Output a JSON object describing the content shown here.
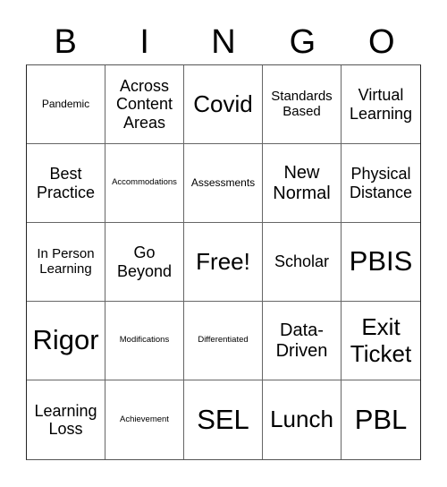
{
  "header": {
    "letters": [
      "B",
      "I",
      "N",
      "G",
      "O"
    ]
  },
  "board": {
    "cells": [
      {
        "text": "Pandemic",
        "size": "s-sm"
      },
      {
        "text": "Across Content Areas",
        "size": "s-lg"
      },
      {
        "text": "Covid",
        "size": "s-2xl"
      },
      {
        "text": "Standards Based",
        "size": "s-md"
      },
      {
        "text": "Virtual Learning",
        "size": "s-lg"
      },
      {
        "text": "Best Practice",
        "size": "s-lg"
      },
      {
        "text": "Accommodations",
        "size": "s-xs"
      },
      {
        "text": "Assessments",
        "size": "s-sm"
      },
      {
        "text": "New Normal",
        "size": "s-xl"
      },
      {
        "text": "Physical Distance",
        "size": "s-lg"
      },
      {
        "text": "In Person Learning",
        "size": "s-md"
      },
      {
        "text": "Go Beyond",
        "size": "s-lg"
      },
      {
        "text": "Free!",
        "size": "s-2xl"
      },
      {
        "text": "Scholar",
        "size": "s-lg"
      },
      {
        "text": "PBIS",
        "size": "s-3xl"
      },
      {
        "text": "Rigor",
        "size": "s-3xl"
      },
      {
        "text": "Modifications",
        "size": "s-xs"
      },
      {
        "text": "Differentiated",
        "size": "s-xs"
      },
      {
        "text": "Data-Driven",
        "size": "s-xl"
      },
      {
        "text": "Exit Ticket",
        "size": "s-2xl"
      },
      {
        "text": "Learning Loss",
        "size": "s-lg"
      },
      {
        "text": "Achievement",
        "size": "s-xs"
      },
      {
        "text": "SEL",
        "size": "s-3xl"
      },
      {
        "text": "Lunch",
        "size": "s-2xl"
      },
      {
        "text": "PBL",
        "size": "s-3xl"
      }
    ]
  }
}
